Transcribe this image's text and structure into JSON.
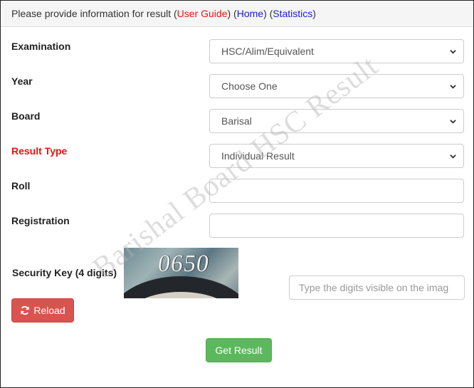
{
  "heading": {
    "text_prefix": "Please provide information for result (",
    "user_guide": "User Guide",
    "mid1": ") (",
    "home": "Home",
    "mid2": ") (",
    "statistics": "Statistics",
    "suffix": ")"
  },
  "watermark": "Barishal Board HSC Result",
  "form": {
    "examination": {
      "label": "Examination",
      "value": "HSC/Alim/Equivalent"
    },
    "year": {
      "label": "Year",
      "value": "Choose One"
    },
    "board": {
      "label": "Board",
      "value": "Barisal"
    },
    "result_type": {
      "label": "Result Type",
      "value": "Individual Result"
    },
    "roll": {
      "label": "Roll",
      "value": ""
    },
    "registration": {
      "label": "Registration",
      "value": ""
    },
    "security_key": {
      "label": "Security Key (4 digits)",
      "captcha_digits": "0650",
      "placeholder": "Type the digits visible on the imag",
      "value": ""
    }
  },
  "buttons": {
    "reload": "Reload",
    "get_result": "Get Result"
  },
  "colors": {
    "label_highlight": "#ee1111",
    "link_blue": "#1a1ad6",
    "reload_bg": "#d9534f",
    "submit_bg": "#5cb85c"
  }
}
